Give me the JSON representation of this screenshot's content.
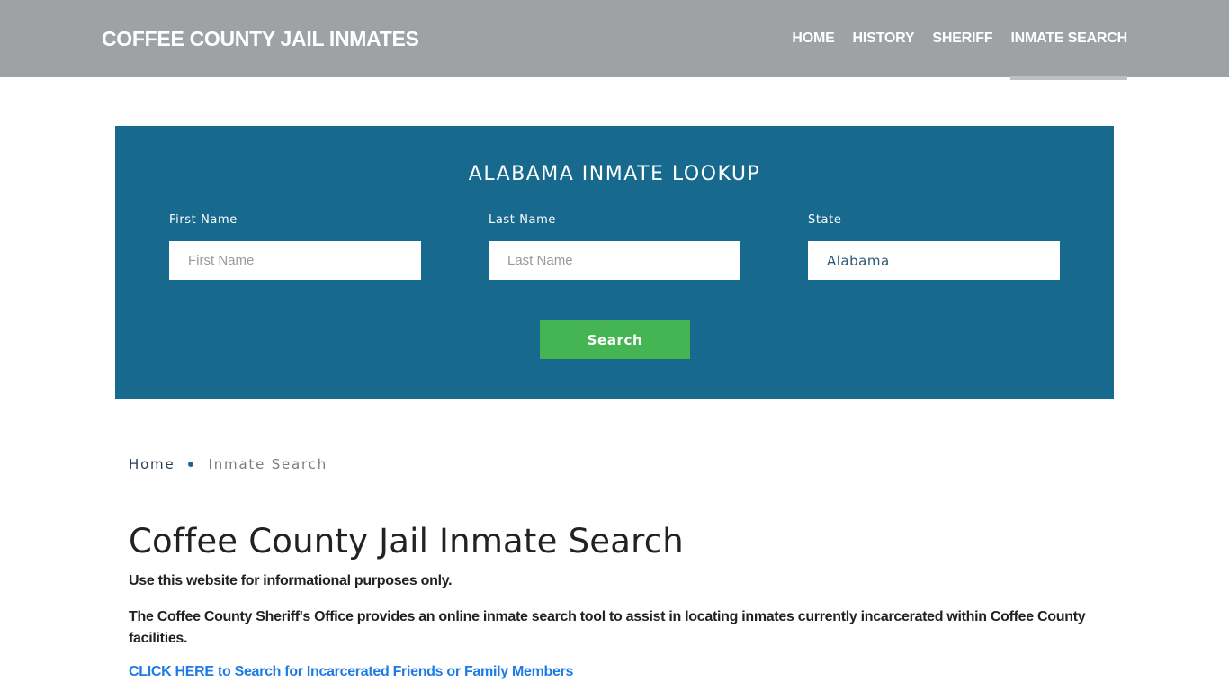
{
  "header": {
    "brand": "COFFEE COUNTY JAIL INMATES",
    "nav": [
      {
        "label": "HOME",
        "active": false
      },
      {
        "label": "HISTORY",
        "active": false
      },
      {
        "label": "SHERIFF",
        "active": false
      },
      {
        "label": "INMATE SEARCH",
        "active": true
      }
    ]
  },
  "lookup": {
    "title": "ALABAMA INMATE LOOKUP",
    "first_name": {
      "label": "First Name",
      "placeholder": "First Name",
      "value": ""
    },
    "last_name": {
      "label": "Last Name",
      "placeholder": "Last Name",
      "value": ""
    },
    "state": {
      "label": "State",
      "value": "Alabama"
    },
    "search_label": "Search",
    "colors": {
      "panel": "#176a8e",
      "button": "#45b553"
    }
  },
  "breadcrumb": {
    "home": "Home",
    "current": "Inmate Search"
  },
  "content": {
    "title": "Coffee County Jail Inmate Search",
    "paragraph1": "Use this website for informational purposes only.",
    "paragraph2": "The Coffee County Sheriff's Office provides an online inmate search tool to assist in locating inmates currently incarcerated within Coffee County facilities.",
    "cta_link": "CLICK HERE to Search for Incarcerated Friends or Family Members"
  }
}
